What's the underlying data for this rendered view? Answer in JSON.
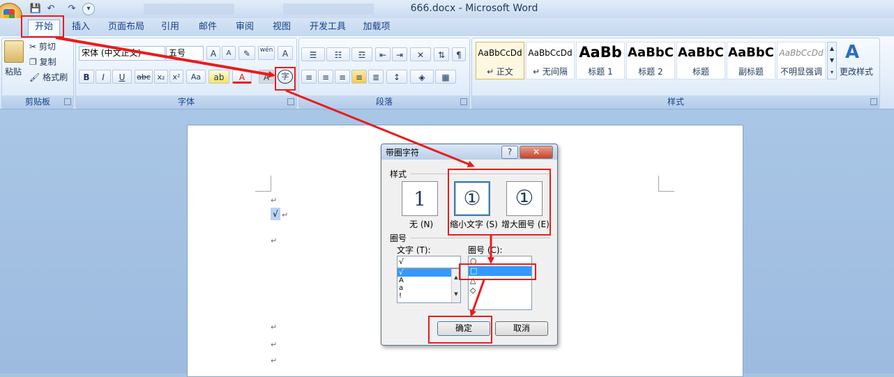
{
  "window": {
    "title": "666.docx - Microsoft Word",
    "qat": {
      "save_icon": "save-icon",
      "undo_icon": "undo-icon",
      "redo_icon": "redo-icon"
    }
  },
  "tabs": [
    "开始",
    "插入",
    "页面布局",
    "引用",
    "邮件",
    "审阅",
    "视图",
    "开发工具",
    "加载项"
  ],
  "ribbon": {
    "clipboard": {
      "label": "剪贴板",
      "paste": "粘贴",
      "cut": "剪切",
      "copy": "复制",
      "format_painter": "格式刷"
    },
    "font": {
      "label": "字体",
      "font_name": "宋体 (中文正文)",
      "font_size": "五号",
      "phonetic": "wén",
      "bold": "B",
      "italic": "I",
      "underline": "U",
      "strike": "abc",
      "sub": "x₂",
      "sup": "x²",
      "aa": "Aa",
      "enclose": "字",
      "shade_a": "A",
      "border_a": "A",
      "color_a": "A"
    },
    "paragraph": {
      "label": "段落"
    },
    "styles": {
      "label": "样式",
      "change_styles": "更改样式",
      "items": [
        {
          "preview": "AaBbCcDd",
          "name": "↵ 正文"
        },
        {
          "preview": "AaBbCcDd",
          "name": "↵ 无间隔"
        },
        {
          "preview": "AaBb",
          "name": "标题 1"
        },
        {
          "preview": "AaBbC",
          "name": "标题 2"
        },
        {
          "preview": "AaBbC",
          "name": "标题"
        },
        {
          "preview": "AaBbC",
          "name": "副标题"
        },
        {
          "preview": "AaBbCcDd",
          "name": "不明显强调"
        }
      ]
    }
  },
  "document": {
    "selected_glyph": "√",
    "para_mark": "↵"
  },
  "dialog": {
    "title": "带圈字符",
    "help": "?",
    "close": "✕",
    "style_section": "样式",
    "styles": [
      {
        "glyph": "1",
        "label": "无 (N)"
      },
      {
        "glyph": "①",
        "label": "缩小文字 (S)"
      },
      {
        "glyph": "①",
        "label": "增大圈号 (E)"
      }
    ],
    "enclosure_section": "圈号",
    "text_label": "文字 (T):",
    "text_value": "√",
    "text_items": [
      "√",
      "A",
      "a",
      "!"
    ],
    "shape_label": "圈号 (C):",
    "shape_items": [
      "○",
      "□",
      "△",
      "◇"
    ],
    "selected_shape_index": 1,
    "ok": "确定",
    "cancel": "取消"
  },
  "annotations": {
    "color": "#e81c1c"
  }
}
